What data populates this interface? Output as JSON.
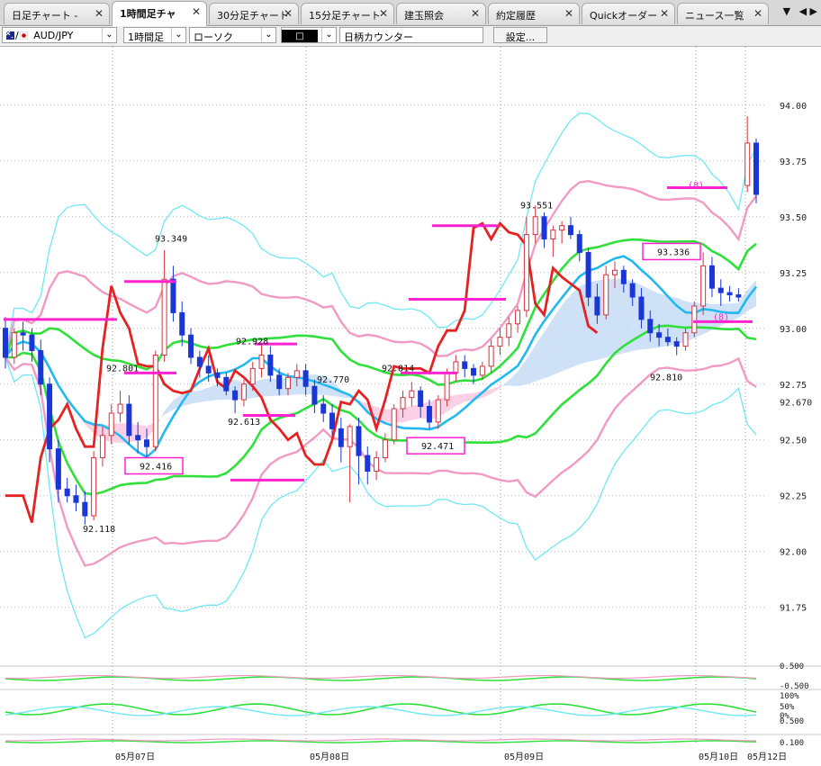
{
  "tabs": [
    {
      "label": "日足チャート -",
      "active": false
    },
    {
      "label": "1時間足チャ",
      "active": true
    },
    {
      "label": "30分足チャート",
      "active": false
    },
    {
      "label": "15分足チャート",
      "active": false
    },
    {
      "label": "建玉照会",
      "active": false
    },
    {
      "label": "約定履歴",
      "active": false
    },
    {
      "label": "Quickオーダー",
      "active": false
    },
    {
      "label": "ニュース一覧",
      "active": false
    }
  ],
  "tab_close_glyph": "✕",
  "toolbar": {
    "symbol": "AUD/JPY",
    "timeframe": "1時間足",
    "chart_style": "ローソク",
    "color_swatch": "□",
    "symbol_search": "日柄カウンター",
    "settings_label": "設定..."
  },
  "colors": {
    "up": "#d4323e",
    "down": "#1a36d6",
    "bb_outer": "#6fe8f6",
    "bb_mid": "#f09ac4",
    "bb_inner": "#2fe03a",
    "ma": "#22b8f0",
    "signal": "#e52222",
    "marker": "#ff22d0",
    "cloud_up": "#c5dcf5",
    "cloud_dn": "#f8c8df"
  },
  "chart_data": {
    "type": "candlestick",
    "instrument": "AUD/JPY",
    "interval": "1時間足",
    "y_ticks": [
      "94.00",
      "93.75",
      "93.50",
      "93.25",
      "93.00",
      "92.75",
      "92.50",
      "92.25",
      "92.00",
      "91.75"
    ],
    "ylim": [
      91.64,
      94.1
    ],
    "current_price_label": "92.670",
    "x_ticks": [
      "05月07日",
      "05月08日",
      "05月09日",
      "05月10日",
      "05月12日"
    ],
    "annotations": [
      {
        "text": "93.349",
        "kind": "high"
      },
      {
        "text": "92.801",
        "kind": "plain"
      },
      {
        "text": "92.416",
        "kind": "boxed"
      },
      {
        "text": "92.118",
        "kind": "low"
      },
      {
        "text": "92.928",
        "kind": "plain"
      },
      {
        "text": "92.613",
        "kind": "plain"
      },
      {
        "text": "92.770",
        "kind": "plain"
      },
      {
        "text": "92.814",
        "kind": "plain"
      },
      {
        "text": "92.471",
        "kind": "boxed"
      },
      {
        "text": "93.551",
        "kind": "high"
      },
      {
        "text": "93.336",
        "kind": "boxed"
      },
      {
        "text": "92.810",
        "kind": "plain"
      },
      {
        "text": "(8)",
        "kind": "count"
      },
      {
        "text": "(8)",
        "kind": "count"
      }
    ],
    "candles_ohlc": [
      [
        93.0,
        93.05,
        92.82,
        92.87
      ],
      [
        92.87,
        93.0,
        92.84,
        92.98
      ],
      [
        92.98,
        93.03,
        92.9,
        92.97
      ],
      [
        92.97,
        93.0,
        92.85,
        92.9
      ],
      [
        92.9,
        92.95,
        92.7,
        92.75
      ],
      [
        92.75,
        92.78,
        92.4,
        92.46
      ],
      [
        92.46,
        92.5,
        92.22,
        92.28
      ],
      [
        92.28,
        92.33,
        92.22,
        92.25
      ],
      [
        92.25,
        92.3,
        92.18,
        92.22
      ],
      [
        92.22,
        92.27,
        92.12,
        92.16
      ],
      [
        92.16,
        92.45,
        92.14,
        92.42
      ],
      [
        92.42,
        92.56,
        92.38,
        92.52
      ],
      [
        92.52,
        92.66,
        92.48,
        92.62
      ],
      [
        92.62,
        92.72,
        92.58,
        92.66
      ],
      [
        92.66,
        92.7,
        92.48,
        92.52
      ],
      [
        92.52,
        92.58,
        92.44,
        92.5
      ],
      [
        92.5,
        92.55,
        92.42,
        92.47
      ],
      [
        92.47,
        92.9,
        92.45,
        92.88
      ],
      [
        92.88,
        93.35,
        92.85,
        93.22
      ],
      [
        93.22,
        93.28,
        93.03,
        93.07
      ],
      [
        93.07,
        93.12,
        92.92,
        92.97
      ],
      [
        92.97,
        93.0,
        92.84,
        92.87
      ],
      [
        92.87,
        92.9,
        92.78,
        92.83
      ],
      [
        92.83,
        92.88,
        92.76,
        92.8
      ],
      [
        92.8,
        92.82,
        92.74,
        92.78
      ],
      [
        92.78,
        92.8,
        92.7,
        92.72
      ],
      [
        92.72,
        92.74,
        92.62,
        92.68
      ],
      [
        92.68,
        92.77,
        92.65,
        92.75
      ],
      [
        92.75,
        92.85,
        92.72,
        92.82
      ],
      [
        92.82,
        92.93,
        92.78,
        92.88
      ],
      [
        92.88,
        92.92,
        92.76,
        92.79
      ],
      [
        92.79,
        92.82,
        92.7,
        92.73
      ],
      [
        92.73,
        92.8,
        92.7,
        92.78
      ],
      [
        92.78,
        92.84,
        92.74,
        92.81
      ],
      [
        92.81,
        92.84,
        92.7,
        92.74
      ],
      [
        92.74,
        92.77,
        92.62,
        92.66
      ],
      [
        92.66,
        92.7,
        92.58,
        92.62
      ],
      [
        92.62,
        92.66,
        92.52,
        92.55
      ],
      [
        92.55,
        92.6,
        92.4,
        92.47
      ],
      [
        92.47,
        92.57,
        92.22,
        92.56
      ],
      [
        92.56,
        92.6,
        92.3,
        92.43
      ],
      [
        92.43,
        92.47,
        92.3,
        92.36
      ],
      [
        92.36,
        92.45,
        92.32,
        92.42
      ],
      [
        92.42,
        92.53,
        92.4,
        92.5
      ],
      [
        92.5,
        92.66,
        92.48,
        92.64
      ],
      [
        92.64,
        92.72,
        92.6,
        92.69
      ],
      [
        92.69,
        92.76,
        92.65,
        92.72
      ],
      [
        92.72,
        92.74,
        92.6,
        92.65
      ],
      [
        92.65,
        92.68,
        92.55,
        92.58
      ],
      [
        92.58,
        92.7,
        92.55,
        92.68
      ],
      [
        92.68,
        92.82,
        92.65,
        92.8
      ],
      [
        92.8,
        92.88,
        92.76,
        92.85
      ],
      [
        92.85,
        92.88,
        92.78,
        92.82
      ],
      [
        92.82,
        92.84,
        92.75,
        92.79
      ],
      [
        92.79,
        92.85,
        92.77,
        92.83
      ],
      [
        92.83,
        92.95,
        92.8,
        92.92
      ],
      [
        92.92,
        93.0,
        92.88,
        92.96
      ],
      [
        92.96,
        93.05,
        92.92,
        93.02
      ],
      [
        93.02,
        93.1,
        92.98,
        93.08
      ],
      [
        93.08,
        93.5,
        93.05,
        93.42
      ],
      [
        93.42,
        93.55,
        93.38,
        93.5
      ],
      [
        93.5,
        93.52,
        93.36,
        93.4
      ],
      [
        93.4,
        93.46,
        93.32,
        93.44
      ],
      [
        93.44,
        93.48,
        93.38,
        93.46
      ],
      [
        93.46,
        93.5,
        93.4,
        93.42
      ],
      [
        93.42,
        93.44,
        93.3,
        93.34
      ],
      [
        93.34,
        93.36,
        93.1,
        93.14
      ],
      [
        93.14,
        93.2,
        93.02,
        93.06
      ],
      [
        93.06,
        93.28,
        93.04,
        93.24
      ],
      [
        93.24,
        93.3,
        93.18,
        93.26
      ],
      [
        93.26,
        93.28,
        93.16,
        93.2
      ],
      [
        93.2,
        93.22,
        93.1,
        93.14
      ],
      [
        93.14,
        93.18,
        93.0,
        93.04
      ],
      [
        93.04,
        93.08,
        92.94,
        92.98
      ],
      [
        92.98,
        93.02,
        92.92,
        92.96
      ],
      [
        92.96,
        93.0,
        92.92,
        92.94
      ],
      [
        92.94,
        92.96,
        92.88,
        92.92
      ],
      [
        92.92,
        93.0,
        92.9,
        92.98
      ],
      [
        92.98,
        93.12,
        92.96,
        93.1
      ],
      [
        93.1,
        93.34,
        93.06,
        93.28
      ],
      [
        93.28,
        93.32,
        93.14,
        93.18
      ],
      [
        93.18,
        93.22,
        93.1,
        93.16
      ],
      [
        93.16,
        93.19,
        93.12,
        93.15
      ],
      [
        93.15,
        93.18,
        93.12,
        93.14
      ],
      [
        93.64,
        93.95,
        93.61,
        93.83
      ],
      [
        93.83,
        93.85,
        93.56,
        93.6
      ]
    ]
  }
}
